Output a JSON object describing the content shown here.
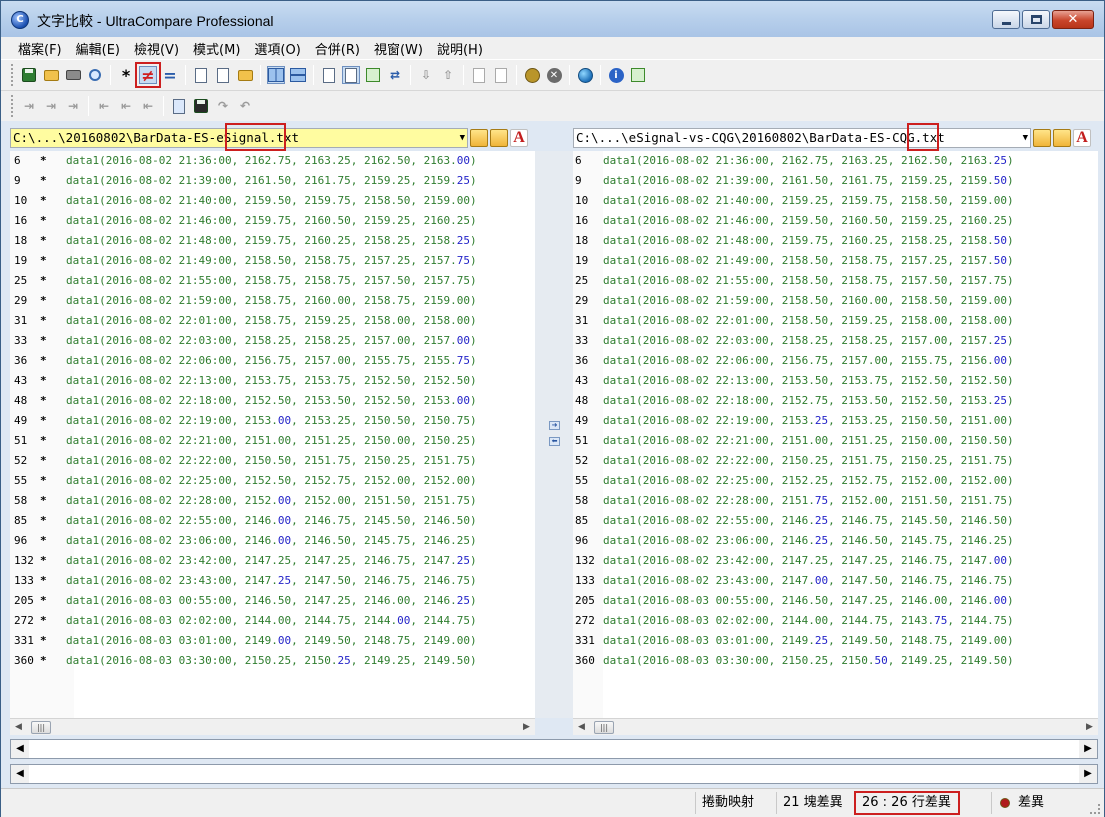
{
  "window": {
    "title": "文字比較 - UltraCompare Professional",
    "close_glyph": "✕"
  },
  "menu": [
    "檔案(F)",
    "編輯(E)",
    "檢視(V)",
    "模式(M)",
    "選項(O)",
    "合併(R)",
    "視窗(W)",
    "說明(H)"
  ],
  "toolbar": {
    "star_glyph": "*",
    "ne_glyph": "≠",
    "eq_glyph": "="
  },
  "left": {
    "path_pre": "C:\\...\\20160802\\BarData-ES-",
    "path_hl": "eSignal",
    "path_post": ".txt",
    "lines": [
      {
        "n": "6",
        "pre": "data1(2016-08-02 21:36:00, 2162.75, 2163.25, 2162.50, 2163.",
        "d": "00",
        "post": ")"
      },
      {
        "n": "9",
        "pre": "data1(2016-08-02 21:39:00, 2161.50, 2161.75, 2159.25, 2159.",
        "d": "25",
        "post": ")"
      },
      {
        "n": "10",
        "pre": "data1(2016-08-02 21:40:00, 2159.50, 2159.75, 2158.50, 2159.00)",
        "d": "",
        "post": ""
      },
      {
        "n": "16",
        "pre": "data1(2016-08-02 21:46:00, 2159.75, 2160.50, 2159.25, 2160.25)",
        "d": "",
        "post": ""
      },
      {
        "n": "18",
        "pre": "data1(2016-08-02 21:48:00, 2159.75, 2160.25, 2158.25, 2158.",
        "d": "25",
        "post": ")"
      },
      {
        "n": "19",
        "pre": "data1(2016-08-02 21:49:00, 2158.50, 2158.75, 2157.25, 2157.",
        "d": "75",
        "post": ")"
      },
      {
        "n": "25",
        "pre": "data1(2016-08-02 21:55:00, 2158.75, 2158.75, 2157.50, 2157.75)",
        "d": "",
        "post": ""
      },
      {
        "n": "29",
        "pre": "data1(2016-08-02 21:59:00, 2158.75, 2160.00, 2158.75, 2159.00)",
        "d": "",
        "post": ""
      },
      {
        "n": "31",
        "pre": "data1(2016-08-02 22:01:00, 2158.75, 2159.25, 2158.00, 2158.00)",
        "d": "",
        "post": ""
      },
      {
        "n": "33",
        "pre": "data1(2016-08-02 22:03:00, 2158.25, 2158.25, 2157.00, 2157.",
        "d": "00",
        "post": ")"
      },
      {
        "n": "36",
        "pre": "data1(2016-08-02 22:06:00, 2156.75, 2157.00, 2155.75, 2155.",
        "d": "75",
        "post": ")"
      },
      {
        "n": "43",
        "pre": "data1(2016-08-02 22:13:00, 2153.75, 2153.75, 2152.50, 2152.50)",
        "d": "",
        "post": ""
      },
      {
        "n": "48",
        "pre": "data1(2016-08-02 22:18:00, 2152.50, 2153.50, 2152.50, 2153.",
        "d": "00",
        "post": ")"
      },
      {
        "n": "49",
        "pre": "data1(2016-08-02 22:19:00, 2153.",
        "d": "00",
        "post": ", 2153.25, 2150.50, 2150.75)"
      },
      {
        "n": "51",
        "pre": "data1(2016-08-02 22:21:00, 2151.00, 2151.25, 2150.00, 2150.25)",
        "d": "",
        "post": ""
      },
      {
        "n": "52",
        "pre": "data1(2016-08-02 22:22:00, 2150.50, 2151.75, 2150.25, 2151.75)",
        "d": "",
        "post": ""
      },
      {
        "n": "55",
        "pre": "data1(2016-08-02 22:25:00, 2152.50, 2152.75, 2152.00, 2152.00)",
        "d": "",
        "post": ""
      },
      {
        "n": "58",
        "pre": "data1(2016-08-02 22:28:00, 2152.",
        "d": "00",
        "post": ", 2152.00, 2151.50, 2151.75)"
      },
      {
        "n": "85",
        "pre": "data1(2016-08-02 22:55:00, 2146.",
        "d": "00",
        "post": ", 2146.75, 2145.50, 2146.50)"
      },
      {
        "n": "96",
        "pre": "data1(2016-08-02 23:06:00, 2146.",
        "d": "00",
        "post": ", 2146.50, 2145.75, 2146.25)"
      },
      {
        "n": "132",
        "pre": "data1(2016-08-02 23:42:00, 2147.25, 2147.25, 2146.75, 2147.",
        "d": "25",
        "post": ")"
      },
      {
        "n": "133",
        "pre": "data1(2016-08-02 23:43:00, 2147.",
        "d": "25",
        "post": ", 2147.50, 2146.75, 2146.75)"
      },
      {
        "n": "205",
        "pre": "data1(2016-08-03 00:55:00, 2146.50, 2147.25, 2146.00, 2146.",
        "d": "25",
        "post": ")"
      },
      {
        "n": "272",
        "pre": "data1(2016-08-03 02:02:00, 2144.00, 2144.75, 2144.",
        "d": "00",
        "post": ", 2144.75)"
      },
      {
        "n": "331",
        "pre": "data1(2016-08-03 03:01:00, 2149.",
        "d": "00",
        "post": ", 2149.50, 2148.75, 2149.00)"
      },
      {
        "n": "360",
        "pre": "data1(2016-08-03 03:30:00, 2150.25, 2150.",
        "d": "25",
        "post": ", 2149.25, 2149.50)"
      }
    ]
  },
  "right": {
    "path_pre": "C:\\...\\eSignal-vs-CQG\\20160802\\BarData-ES-",
    "path_hl": "CQG",
    "path_post": ".txt",
    "lines": [
      {
        "n": "6",
        "pre": "data1(2016-08-02 21:36:00, 2162.75, 2163.25, 2162.50, 2163.",
        "d": "25",
        "post": ")"
      },
      {
        "n": "9",
        "pre": "data1(2016-08-02 21:39:00, 2161.50, 2161.75, 2159.25, 2159.",
        "d": "50",
        "post": ")"
      },
      {
        "n": "10",
        "pre": "data1(2016-08-02 21:40:00, 2159.25, 2159.75, 2158.50, 2159.00)",
        "d": "",
        "post": ""
      },
      {
        "n": "16",
        "pre": "data1(2016-08-02 21:46:00, 2159.50, 2160.50, 2159.25, 2160.25)",
        "d": "",
        "post": ""
      },
      {
        "n": "18",
        "pre": "data1(2016-08-02 21:48:00, 2159.75, 2160.25, 2158.25, 2158.",
        "d": "50",
        "post": ")"
      },
      {
        "n": "19",
        "pre": "data1(2016-08-02 21:49:00, 2158.50, 2158.75, 2157.25, 2157.",
        "d": "50",
        "post": ")"
      },
      {
        "n": "25",
        "pre": "data1(2016-08-02 21:55:00, 2158.50, 2158.75, 2157.50, 2157.75)",
        "d": "",
        "post": ""
      },
      {
        "n": "29",
        "pre": "data1(2016-08-02 21:59:00, 2158.50, 2160.00, 2158.50, 2159.00)",
        "d": "",
        "post": ""
      },
      {
        "n": "31",
        "pre": "data1(2016-08-02 22:01:00, 2158.50, 2159.25, 2158.00, 2158.00)",
        "d": "",
        "post": ""
      },
      {
        "n": "33",
        "pre": "data1(2016-08-02 22:03:00, 2158.25, 2158.25, 2157.00, 2157.",
        "d": "25",
        "post": ")"
      },
      {
        "n": "36",
        "pre": "data1(2016-08-02 22:06:00, 2156.75, 2157.00, 2155.75, 2156.",
        "d": "00",
        "post": ")"
      },
      {
        "n": "43",
        "pre": "data1(2016-08-02 22:13:00, 2153.50, 2153.75, 2152.50, 2152.50)",
        "d": "",
        "post": ""
      },
      {
        "n": "48",
        "pre": "data1(2016-08-02 22:18:00, 2152.75, 2153.50, 2152.50, 2153.",
        "d": "25",
        "post": ")"
      },
      {
        "n": "49",
        "pre": "data1(2016-08-02 22:19:00, 2153.",
        "d": "25",
        "post": ", 2153.25, 2150.50, 2151.00)"
      },
      {
        "n": "51",
        "pre": "data1(2016-08-02 22:21:00, 2151.00, 2151.25, 2150.00, 2150.50)",
        "d": "",
        "post": ""
      },
      {
        "n": "52",
        "pre": "data1(2016-08-02 22:22:00, 2150.25, 2151.75, 2150.25, 2151.75)",
        "d": "",
        "post": ""
      },
      {
        "n": "55",
        "pre": "data1(2016-08-02 22:25:00, 2152.25, 2152.75, 2152.00, 2152.00)",
        "d": "",
        "post": ""
      },
      {
        "n": "58",
        "pre": "data1(2016-08-02 22:28:00, 2151.",
        "d": "75",
        "post": ", 2152.00, 2151.50, 2151.75)"
      },
      {
        "n": "85",
        "pre": "data1(2016-08-02 22:55:00, 2146.",
        "d": "25",
        "post": ", 2146.75, 2145.50, 2146.50)"
      },
      {
        "n": "96",
        "pre": "data1(2016-08-02 23:06:00, 2146.",
        "d": "25",
        "post": ", 2146.50, 2145.75, 2146.25)"
      },
      {
        "n": "132",
        "pre": "data1(2016-08-02 23:42:00, 2147.25, 2147.25, 2146.75, 2147.",
        "d": "00",
        "post": ")"
      },
      {
        "n": "133",
        "pre": "data1(2016-08-02 23:43:00, 2147.",
        "d": "00",
        "post": ", 2147.50, 2146.75, 2146.75)"
      },
      {
        "n": "205",
        "pre": "data1(2016-08-03 00:55:00, 2146.50, 2147.25, 2146.00, 2146.",
        "d": "00",
        "post": ")"
      },
      {
        "n": "272",
        "pre": "data1(2016-08-03 02:02:00, 2144.00, 2144.75, 2143.",
        "d": "75",
        "post": ", 2144.75)"
      },
      {
        "n": "331",
        "pre": "data1(2016-08-03 03:01:00, 2149.",
        "d": "25",
        "post": ", 2149.50, 2148.75, 2149.00)"
      },
      {
        "n": "360",
        "pre": "data1(2016-08-03 03:30:00, 2150.25, 2150.",
        "d": "50",
        "post": ", 2149.25, 2149.50)"
      }
    ]
  },
  "status": {
    "map": "捲動映射",
    "blocks": "21 塊差異",
    "lines": "26 : 26 行差異",
    "diff": "差異"
  },
  "colors": {
    "diff_text": "#2323c8",
    "same_text": "#2e7d2e",
    "highlight": "#cc1f1f",
    "left_path_bg": "#fffca0"
  }
}
